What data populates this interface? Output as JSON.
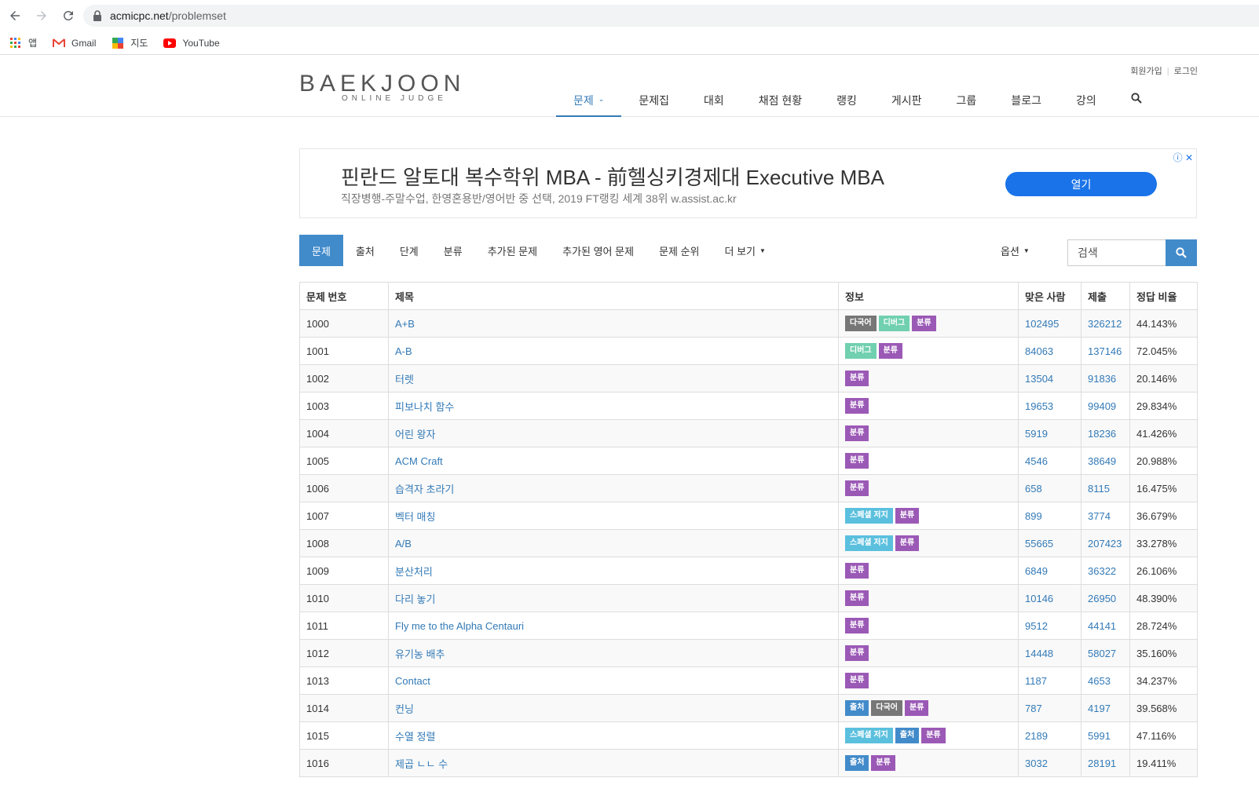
{
  "browser": {
    "url_host": "acmicpc.net",
    "url_path": "/problemset",
    "bookmarks": [
      {
        "label": "앱",
        "icon": "apps-grid-icon"
      },
      {
        "label": "Gmail",
        "icon": "gmail-icon"
      },
      {
        "label": "지도",
        "icon": "maps-icon"
      },
      {
        "label": "YouTube",
        "icon": "youtube-icon"
      }
    ]
  },
  "header": {
    "logo_main": "BAEKJOON",
    "logo_sub": "ONLINE JUDGE",
    "signup": "회원가입",
    "login": "로그인",
    "nav": [
      "문제",
      "문제집",
      "대회",
      "채점 현황",
      "랭킹",
      "게시판",
      "그룹",
      "블로그",
      "강의"
    ]
  },
  "ad": {
    "title": "핀란드 알토대 복수학위 MBA - 前헬싱키경제대 Executive MBA",
    "subtitle": "직장병행-주말수업, 한영혼용반/영어반 중 선택, 2019 FT랭킹 세계 38위 w.assist.ac.kr",
    "button": "열기"
  },
  "subtabs": [
    "문제",
    "출처",
    "단계",
    "분류",
    "추가된 문제",
    "추가된 영어 문제",
    "문제 순위",
    "더 보기"
  ],
  "options_label": "옵션",
  "search_placeholder": "검색",
  "table": {
    "headers": [
      "문제 번호",
      "제목",
      "정보",
      "맞은 사람",
      "제출",
      "정답 비율"
    ],
    "tag_colors": {
      "다국어": "#777777",
      "디버그": "#70d0b0",
      "분류": "#9b59b6",
      "스페셜 저지": "#5bc0de",
      "출처": "#428bca"
    },
    "rows": [
      {
        "id": "1000",
        "title": "A+B",
        "tags": [
          "다국어",
          "디버그",
          "분류"
        ],
        "solved": "102495",
        "submits": "326212",
        "ratio": "44.143%"
      },
      {
        "id": "1001",
        "title": "A-B",
        "tags": [
          "디버그",
          "분류"
        ],
        "solved": "84063",
        "submits": "137146",
        "ratio": "72.045%"
      },
      {
        "id": "1002",
        "title": "터렛",
        "tags": [
          "분류"
        ],
        "solved": "13504",
        "submits": "91836",
        "ratio": "20.146%"
      },
      {
        "id": "1003",
        "title": "피보나치 함수",
        "tags": [
          "분류"
        ],
        "solved": "19653",
        "submits": "99409",
        "ratio": "29.834%"
      },
      {
        "id": "1004",
        "title": "어린 왕자",
        "tags": [
          "분류"
        ],
        "solved": "5919",
        "submits": "18236",
        "ratio": "41.426%"
      },
      {
        "id": "1005",
        "title": "ACM Craft",
        "tags": [
          "분류"
        ],
        "solved": "4546",
        "submits": "38649",
        "ratio": "20.988%"
      },
      {
        "id": "1006",
        "title": "습격자 초라기",
        "tags": [
          "분류"
        ],
        "solved": "658",
        "submits": "8115",
        "ratio": "16.475%"
      },
      {
        "id": "1007",
        "title": "벡터 매칭",
        "tags": [
          "스페셜 저지",
          "분류"
        ],
        "solved": "899",
        "submits": "3774",
        "ratio": "36.679%"
      },
      {
        "id": "1008",
        "title": "A/B",
        "tags": [
          "스페셜 저지",
          "분류"
        ],
        "solved": "55665",
        "submits": "207423",
        "ratio": "33.278%"
      },
      {
        "id": "1009",
        "title": "분산처리",
        "tags": [
          "분류"
        ],
        "solved": "6849",
        "submits": "36322",
        "ratio": "26.106%"
      },
      {
        "id": "1010",
        "title": "다리 놓기",
        "tags": [
          "분류"
        ],
        "solved": "10146",
        "submits": "26950",
        "ratio": "48.390%"
      },
      {
        "id": "1011",
        "title": "Fly me to the Alpha Centauri",
        "tags": [
          "분류"
        ],
        "solved": "9512",
        "submits": "44141",
        "ratio": "28.724%"
      },
      {
        "id": "1012",
        "title": "유기농 배추",
        "tags": [
          "분류"
        ],
        "solved": "14448",
        "submits": "58027",
        "ratio": "35.160%"
      },
      {
        "id": "1013",
        "title": "Contact",
        "tags": [
          "분류"
        ],
        "solved": "1187",
        "submits": "4653",
        "ratio": "34.237%"
      },
      {
        "id": "1014",
        "title": "컨닝",
        "tags": [
          "출처",
          "다국어",
          "분류"
        ],
        "solved": "787",
        "submits": "4197",
        "ratio": "39.568%"
      },
      {
        "id": "1015",
        "title": "수열 정렬",
        "tags": [
          "스페셜 저지",
          "출처",
          "분류"
        ],
        "solved": "2189",
        "submits": "5991",
        "ratio": "47.116%"
      },
      {
        "id": "1016",
        "title": "제곱 ㄴㄴ 수",
        "tags": [
          "출처",
          "분류"
        ],
        "solved": "3032",
        "submits": "28191",
        "ratio": "19.411%"
      }
    ]
  }
}
